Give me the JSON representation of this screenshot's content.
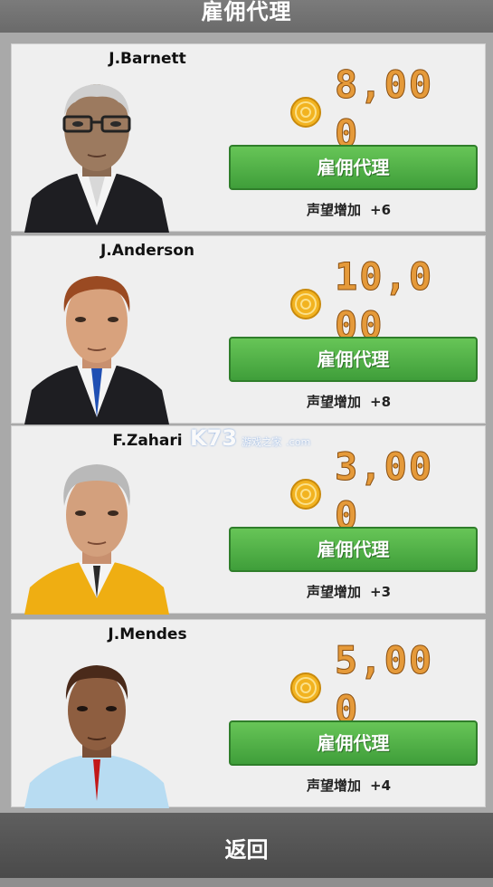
{
  "header": {
    "title": "雇佣代理"
  },
  "agents": [
    {
      "name": "J.Barnett",
      "price": "8,000",
      "hire_label": "雇佣代理",
      "reputation_label": "声望增加",
      "reputation_value": "+6"
    },
    {
      "name": "J.Anderson",
      "price": "10,000",
      "hire_label": "雇佣代理",
      "reputation_label": "声望增加",
      "reputation_value": "+8"
    },
    {
      "name": "F.Zahari",
      "price": "3,000",
      "hire_label": "雇佣代理",
      "reputation_label": "声望增加",
      "reputation_value": "+3"
    },
    {
      "name": "J.Mendes",
      "price": "5,000",
      "hire_label": "雇佣代理",
      "reputation_label": "声望增加",
      "reputation_value": "+4"
    }
  ],
  "footer": {
    "back_label": "返回"
  },
  "watermark": {
    "text": "K73",
    "sub": "游戏之家",
    "url": ".com"
  },
  "colors": {
    "button": "#4caf45",
    "price": "#e59a3a",
    "card": "#efefef"
  }
}
